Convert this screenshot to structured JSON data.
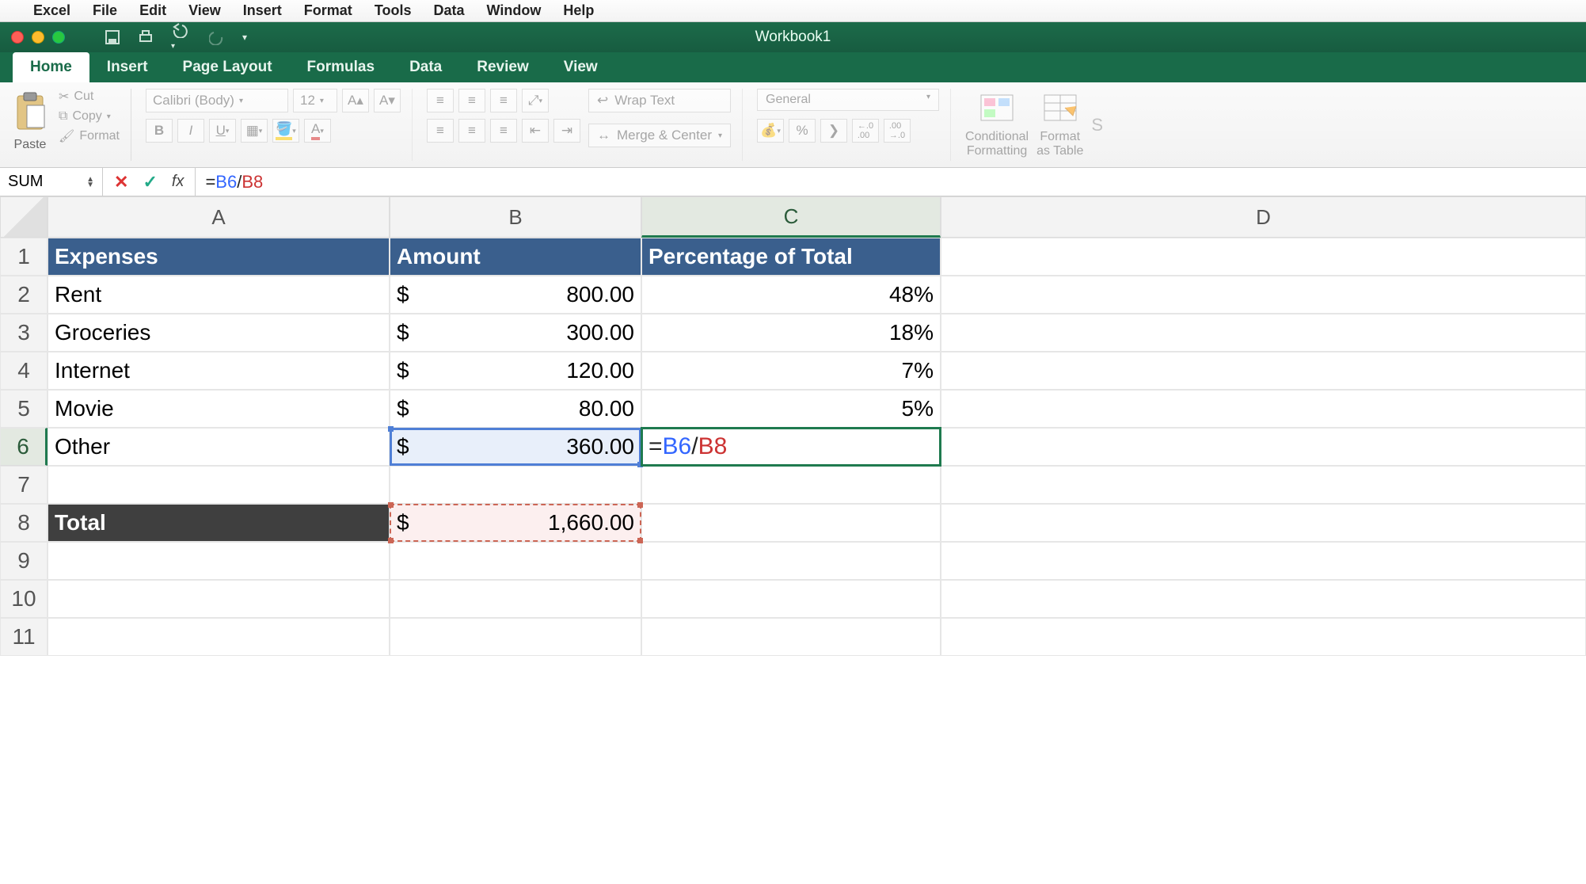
{
  "mac_menu": {
    "app": "Excel",
    "items": [
      "File",
      "Edit",
      "View",
      "Insert",
      "Format",
      "Tools",
      "Data",
      "Window",
      "Help"
    ]
  },
  "titlebar": {
    "doc": "Workbook1"
  },
  "ribbon_tabs": {
    "active": "Home",
    "tabs": [
      "Home",
      "Insert",
      "Page Layout",
      "Formulas",
      "Data",
      "Review",
      "View"
    ]
  },
  "ribbon": {
    "paste": "Paste",
    "cut": "Cut",
    "copy": "Copy",
    "format_painter": "Format",
    "font_name": "Calibri (Body)",
    "font_size": "12",
    "wrap": "Wrap Text",
    "merge": "Merge & Center",
    "num_format": "General",
    "cond_fmt": "Conditional\nFormatting",
    "fmt_table": "Format\nas Table"
  },
  "formula_bar": {
    "name_box": "SUM",
    "formula_prefix": "=",
    "formula_ref1": "B6",
    "formula_op": "/",
    "formula_ref2": "B8"
  },
  "grid": {
    "col_headers": [
      "A",
      "B",
      "C",
      "D"
    ],
    "row_headers": [
      "1",
      "2",
      "3",
      "4",
      "5",
      "6",
      "7",
      "8",
      "9",
      "10",
      "11"
    ],
    "header_row": {
      "A": "Expenses",
      "B": "Amount",
      "C": "Percentage of Total"
    },
    "rows": [
      {
        "A": "Rent",
        "B_sym": "$",
        "B_val": "800.00",
        "C": "48%"
      },
      {
        "A": "Groceries",
        "B_sym": "$",
        "B_val": "300.00",
        "C": "18%"
      },
      {
        "A": "Internet",
        "B_sym": "$",
        "B_val": "120.00",
        "C": "7%"
      },
      {
        "A": "Movie",
        "B_sym": "$",
        "B_val": "80.00",
        "C": "5%"
      },
      {
        "A": "Other",
        "B_sym": "$",
        "B_val": "360.00",
        "C_formula": {
          "eq": "=",
          "ref1": "B6",
          "op": "/",
          "ref2": "B8"
        }
      }
    ],
    "total_row": {
      "A": "Total",
      "B_sym": "$",
      "B_val": "1,660.00"
    },
    "active_cell": "C6"
  }
}
